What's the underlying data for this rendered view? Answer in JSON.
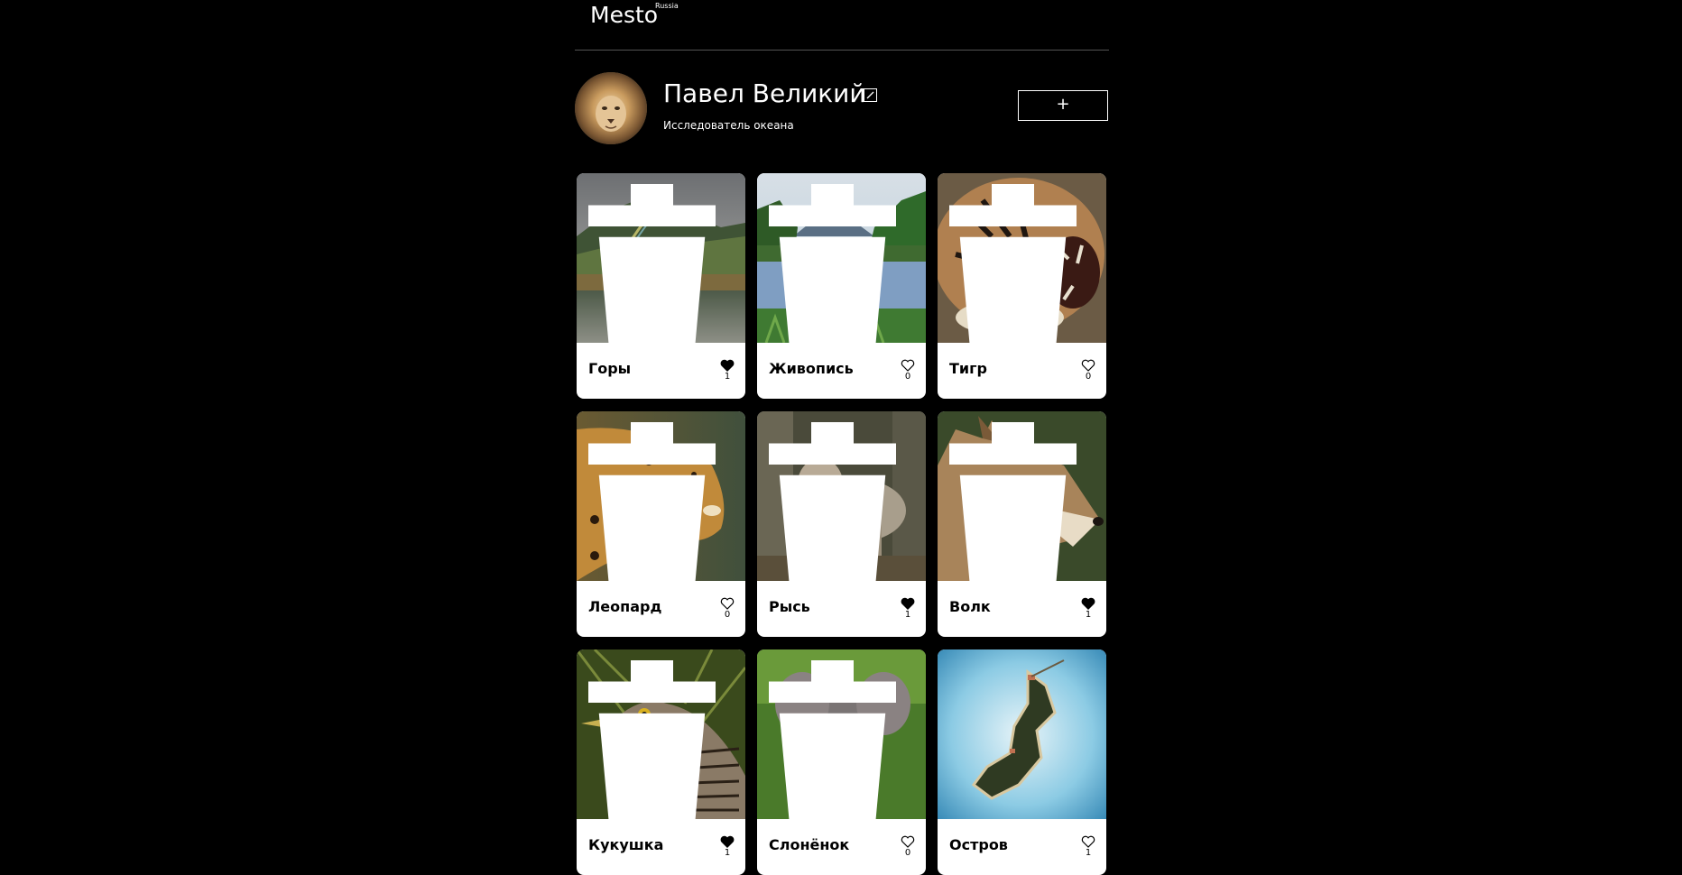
{
  "header": {
    "logo": "Mesto",
    "logo_sup": "Russia"
  },
  "profile": {
    "name": "Павел Великий",
    "about": "Исследователь океана",
    "add_label": "+"
  },
  "cards": [
    {
      "title": "Горы",
      "likes": "1",
      "liked": true,
      "has_trash": true
    },
    {
      "title": "Живопись",
      "likes": "0",
      "liked": false,
      "has_trash": true
    },
    {
      "title": "Тигр",
      "likes": "0",
      "liked": false,
      "has_trash": true
    },
    {
      "title": "Леопард",
      "likes": "0",
      "liked": false,
      "has_trash": true
    },
    {
      "title": "Рысь",
      "likes": "1",
      "liked": true,
      "has_trash": true
    },
    {
      "title": "Волк",
      "likes": "1",
      "liked": true,
      "has_trash": true
    },
    {
      "title": "Кукушка",
      "likes": "1",
      "liked": true,
      "has_trash": true
    },
    {
      "title": "Слонёнок",
      "likes": "0",
      "liked": false,
      "has_trash": true
    },
    {
      "title": "Остров",
      "likes": "1",
      "liked": false,
      "has_trash": false
    }
  ]
}
